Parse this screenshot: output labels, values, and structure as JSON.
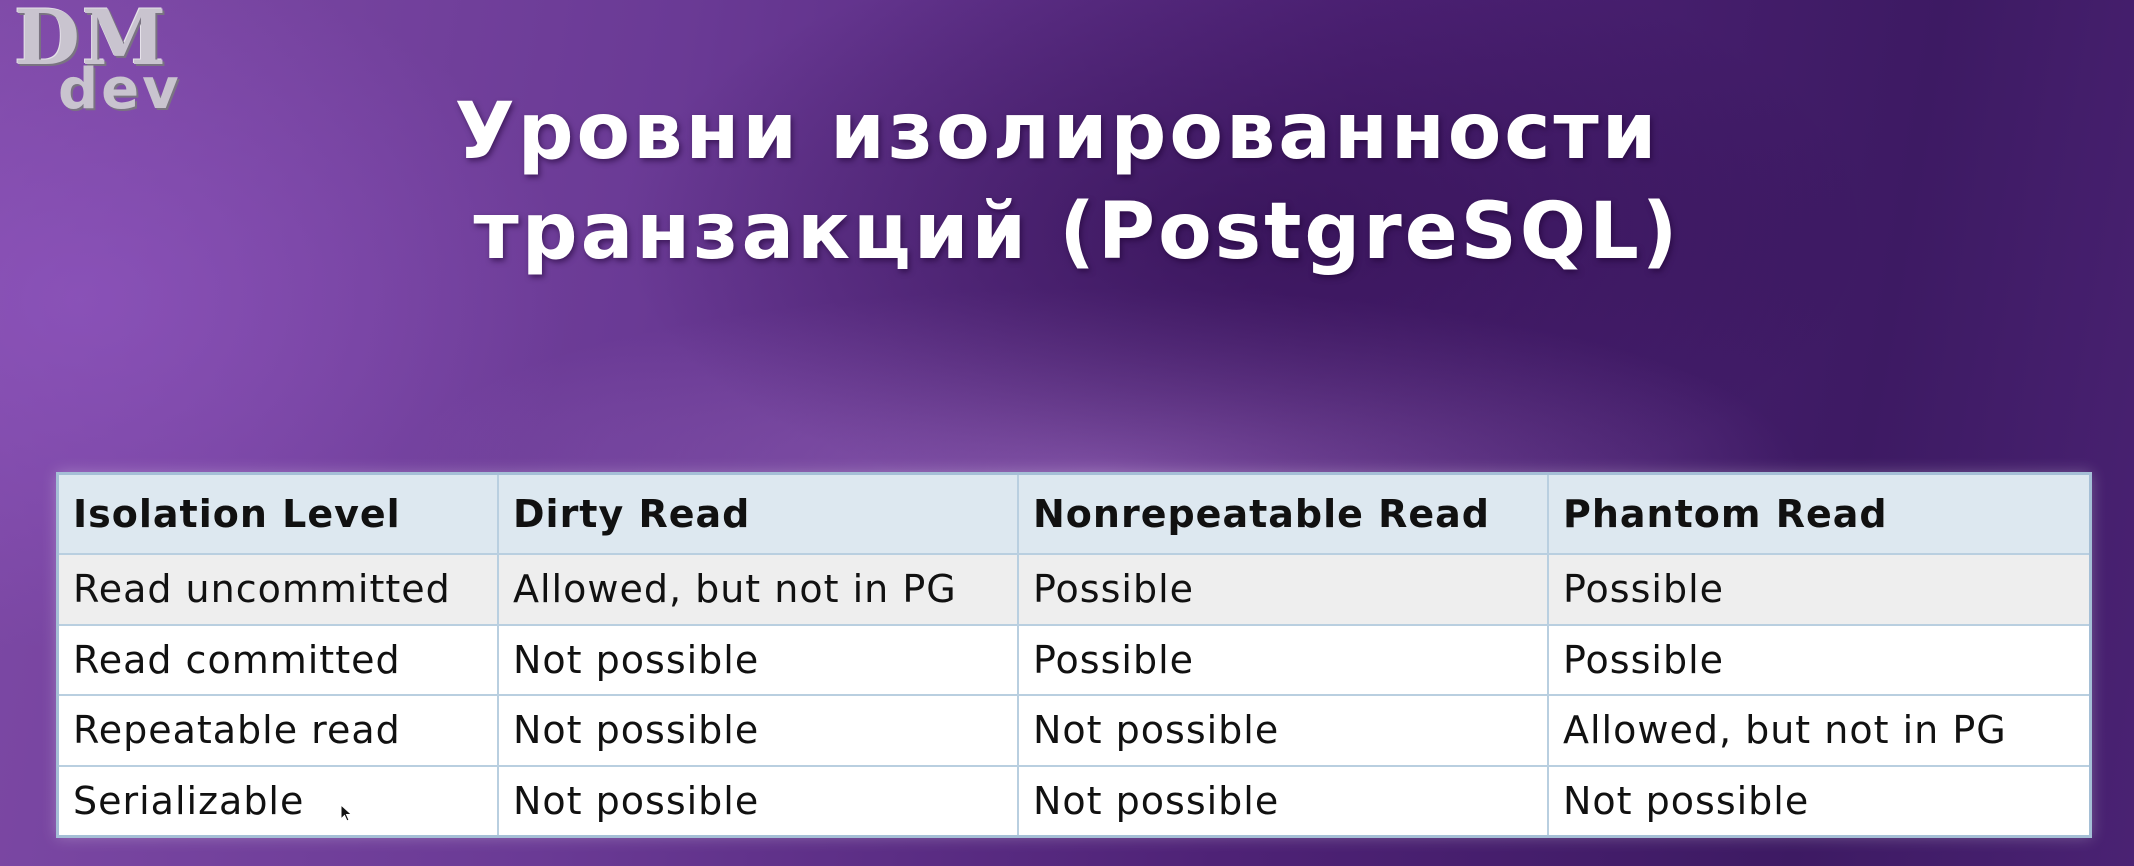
{
  "logo": {
    "line1": "DM",
    "line2": "dev"
  },
  "title": {
    "line1": "Уровни изолированности",
    "line2": "транзакций (PostgreSQL)"
  },
  "table": {
    "headers": [
      "Isolation Level",
      "Dirty Read",
      "Nonrepeatable Read",
      "Phantom Read"
    ],
    "rows": [
      [
        "Read uncommitted",
        "Allowed, but not in PG",
        "Possible",
        "Possible"
      ],
      [
        "Read committed",
        "Not possible",
        "Possible",
        "Possible"
      ],
      [
        "Repeatable read",
        "Not possible",
        "Not possible",
        "Allowed, but not in PG"
      ],
      [
        "Serializable",
        "Not possible",
        "Not possible",
        "Not possible"
      ]
    ]
  },
  "cursor": {
    "icon": "mouse-pointer-icon"
  },
  "colors": {
    "background_dark": "#3d1a63",
    "background_light": "#7e4aa6",
    "title_text": "#ffffff",
    "table_header_bg": "#dde8f0",
    "table_border": "#a5bfd6",
    "shaded_row_bg": "#eeeeee"
  }
}
